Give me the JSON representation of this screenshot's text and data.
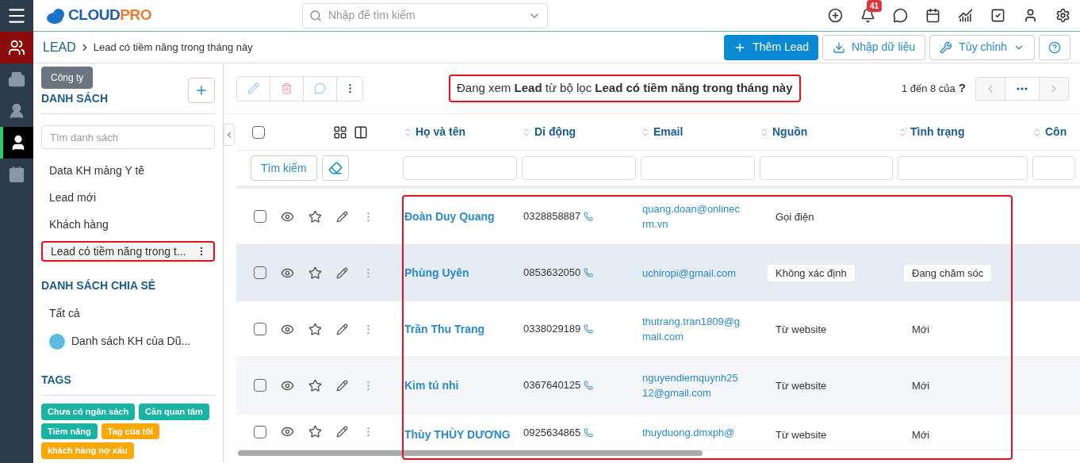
{
  "logo": {
    "brand": "CLOUD",
    "accent": "PRO"
  },
  "rail": [
    {
      "selected": true,
      "hovered": false
    },
    {
      "selected": false,
      "hovered": false
    },
    {
      "selected": false,
      "hovered": false
    },
    {
      "selected": false,
      "hovered": true
    },
    {
      "selected": false,
      "hovered": false
    }
  ],
  "tooltip": "Công ty",
  "search": {
    "placeholder": "Nhập để tìm kiếm"
  },
  "notification_count": "41",
  "breadcrumb": {
    "module": "LEAD",
    "current": "Lead có tiềm năng trong tháng này"
  },
  "actions": [
    "Thêm Lead",
    "Nhập dữ liệu",
    "Tùy chỉnh"
  ],
  "sidebar": {
    "title": "DANH SÁCH",
    "search_placeholder": "Tìm danh sách",
    "lists": [
      {
        "label": "Data KH mảng Y tê",
        "selected": false
      },
      {
        "label": "Lead mới",
        "selected": false
      },
      {
        "label": "Khách hàng",
        "selected": false
      },
      {
        "label": "Lead có tiềm năng trong t...",
        "selected": true
      }
    ],
    "shared_title": "DANH SÁCH CHIA SẺ",
    "shared": [
      {
        "label": "Tất cả",
        "avatar": false
      },
      {
        "label": "Danh sách KH của Dũ...",
        "avatar": true
      }
    ],
    "tags_title": "TAGS",
    "tags": [
      {
        "label": "Chưa có ngân sách",
        "color": "#17b3a3"
      },
      {
        "label": "Cần quan tâm",
        "color": "#17b3a3"
      },
      {
        "label": "Tiềm năng",
        "color": "#17b3a3"
      },
      {
        "label": "Tag của tôi",
        "color": "#f9a806"
      },
      {
        "label": "khách hàng nợ xấu",
        "color": "#f9a806"
      }
    ]
  },
  "filter_banner": "Đang xem **Lead** từ bộ lọc **Lead có tiềm năng trong tháng này**",
  "pagination": {
    "range": "1 đến 8 của",
    "total": "?"
  },
  "table": {
    "columns": [
      "Họ và tên",
      "Di động",
      "Email",
      "Nguồn",
      "Tình trạng",
      "Côn"
    ],
    "search_button": "Tìm kiếm",
    "select_all_checked": false,
    "rows": [
      {
        "name": "Đoàn Duy Quang",
        "phone": "0328858887",
        "email": "quang.doan@onlinecrm.vn",
        "source": "Gọi điện",
        "status": "",
        "hovered": false
      },
      {
        "name": "Phùng Uyên",
        "phone": "0853632050",
        "email": "uchiropi@gmail.com",
        "source": "Không xác định",
        "status": "Đang chăm sóc",
        "hovered": true
      },
      {
        "name": "Trần Thu Trang",
        "phone": "0338029189",
        "email": "thutrang.tran1809@gmail.com",
        "source": "Từ website",
        "status": "Mới",
        "hovered": false
      },
      {
        "name": "Kim tú nhi",
        "phone": "0367640125",
        "email": "nguyendiemquynh2512@gmail.com",
        "source": "Từ website",
        "status": "Mới",
        "hovered": false
      },
      {
        "name": "Thùy THÙY DƯƠNG",
        "phone": "0925634865",
        "email": "thuyduong.dmxph@",
        "source": "Từ website",
        "status": "Mới",
        "hovered": false
      }
    ]
  }
}
